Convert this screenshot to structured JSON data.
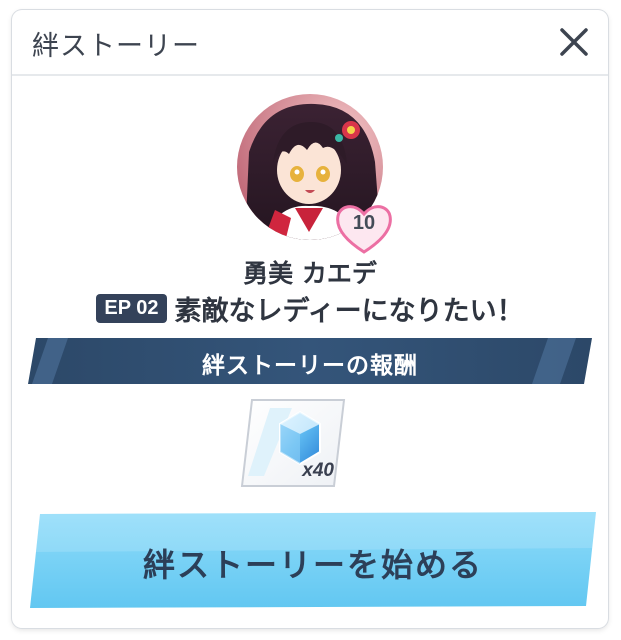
{
  "dialog": {
    "title": "絆ストーリー",
    "close_icon": "close-icon"
  },
  "character": {
    "name": "勇美 カエデ",
    "affinity_level": "10",
    "portrait": "character-portrait"
  },
  "episode": {
    "badge": "EP 02",
    "title": "素敵なレディーになりたい！"
  },
  "rewards": {
    "heading": "絆ストーリーの報酬",
    "items": [
      {
        "icon": "blue-gem-icon",
        "quantity": "x40"
      }
    ]
  },
  "actions": {
    "start_label": "絆ストーリーを始める"
  },
  "colors": {
    "banner": "#2e4a6e",
    "button": "#74d0f4",
    "badge": "#34425a"
  }
}
